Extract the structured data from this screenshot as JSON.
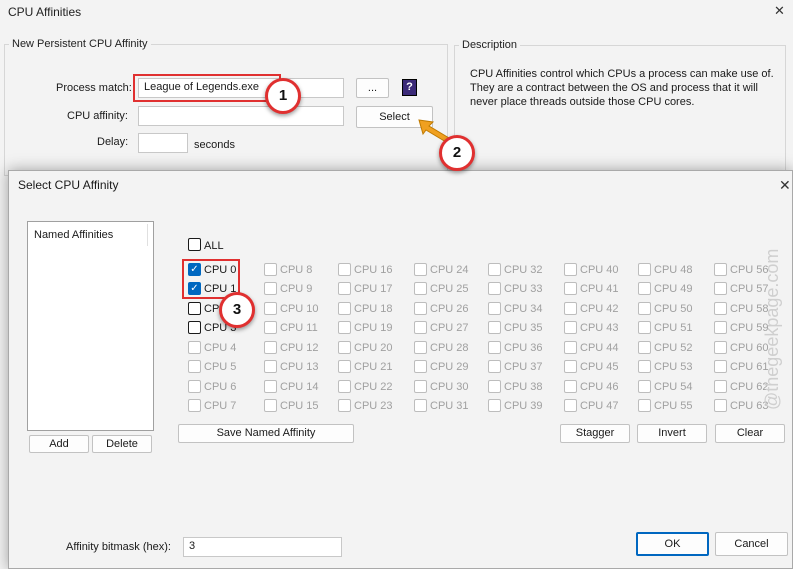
{
  "window": {
    "title": "CPU Affinities",
    "close_glyph": "✕"
  },
  "group": {
    "title": "New Persistent CPU Affinity",
    "process_label": "Process match:",
    "process_value": "League of Legends.exe",
    "browse_label": "...",
    "help_label": "?",
    "affinity_label": "CPU affinity:",
    "affinity_value": "",
    "select_label": "Select",
    "delay_label": "Delay:",
    "delay_value": "",
    "seconds_label": "seconds"
  },
  "description": {
    "title": "Description",
    "text": "CPU Affinities control which CPUs a process can make use of. They are a contract between the OS and process that it will never place threads outside those CPU cores."
  },
  "dialog": {
    "title": "Select CPU Affinity",
    "close_glyph": "✕",
    "named_affinities_header": "Named Affinities",
    "add_label": "Add",
    "delete_label": "Delete",
    "all_label": "ALL",
    "cpu_checked": [
      "CPU 0",
      "CPU 1"
    ],
    "cpu_enabled_unchecked": [
      "CPU 2",
      "CPU 3"
    ],
    "save_named_label": "Save Named Affinity",
    "stagger_label": "Stagger",
    "invert_label": "Invert",
    "clear_label": "Clear",
    "bitmask_label": "Affinity bitmask (hex):",
    "bitmask_value": "3",
    "ok_label": "OK",
    "cancel_label": "Cancel"
  },
  "annotations": {
    "step1": "1",
    "step2": "2",
    "step3": "3",
    "arrow_color": "#f0a020",
    "highlight_color": "#e03030"
  },
  "watermark": "@thegeekpage.com"
}
